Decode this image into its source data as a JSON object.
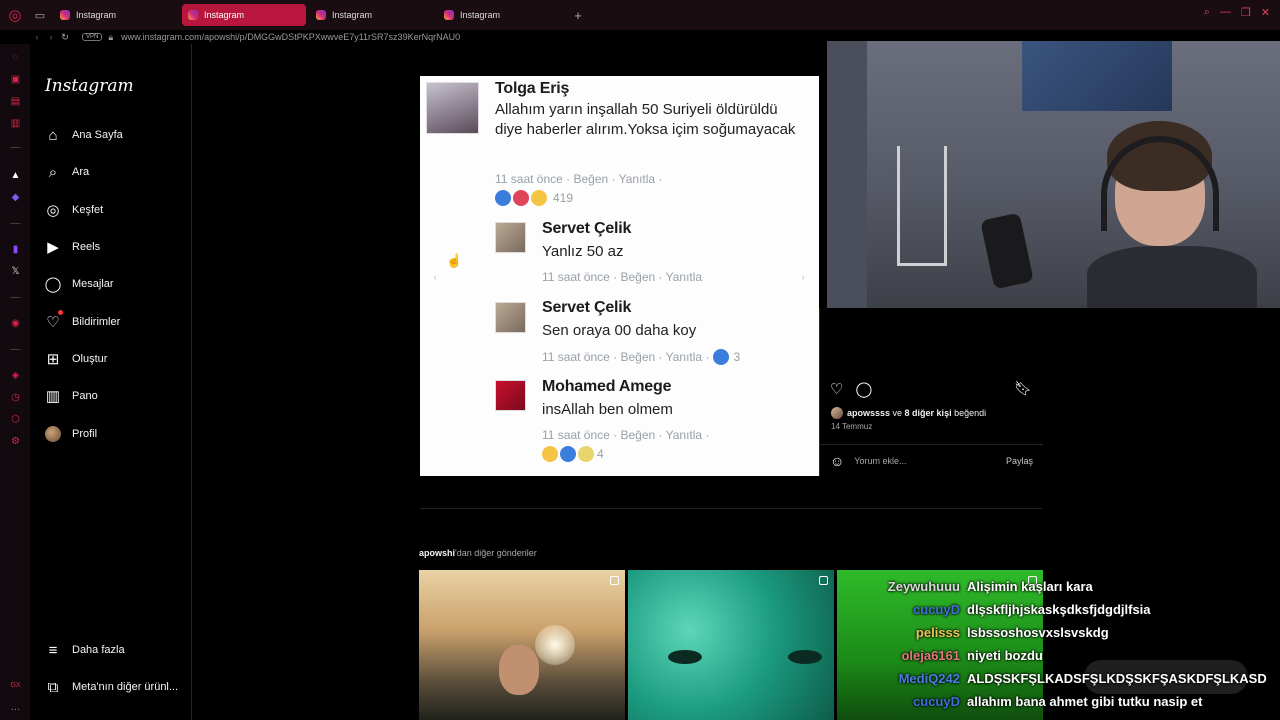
{
  "browser": {
    "tabs": [
      {
        "label": "Instagram",
        "active": false
      },
      {
        "label": "Instagram",
        "active": true
      },
      {
        "label": "Instagram",
        "active": false
      },
      {
        "label": "Instagram",
        "active": false
      }
    ],
    "new_tab": "+",
    "vpn": "VPN",
    "url": "www.instagram.com/apowshi/p/DMGGwDStPKPXwwveE7y11rSR7sz39KerNqrNAU0",
    "colors": {
      "accent": "#b8163c",
      "brand": "#d8264b"
    }
  },
  "instagram_nav": {
    "logo": "Instagram",
    "items": [
      {
        "label": "Ana Sayfa",
        "icon": "home-icon"
      },
      {
        "label": "Ara",
        "icon": "search-icon"
      },
      {
        "label": "Keşfet",
        "icon": "compass-icon"
      },
      {
        "label": "Reels",
        "icon": "reels-icon"
      },
      {
        "label": "Mesajlar",
        "icon": "messenger-icon"
      },
      {
        "label": "Bildirimler",
        "icon": "heart-icon"
      },
      {
        "label": "Oluştur",
        "icon": "plus-square-icon"
      },
      {
        "label": "Pano",
        "icon": "dashboard-icon"
      },
      {
        "label": "Profil",
        "icon": "avatar"
      }
    ],
    "more": "Daha fazla",
    "meta": "Meta'nın diğer ürünl..."
  },
  "post_image": {
    "comments": [
      {
        "name": "Tolga Eriş",
        "text": "Allahım yarın inşallah 50 Suriyeli öldürüldü diye haberler alırım.Yoksa içim soğumayacak",
        "meta": "11 saat önce · Beğen · Yanıtla ·",
        "count": "419"
      },
      {
        "name": "Servet Çelik",
        "text": "Yanlız 50 az",
        "meta": "11 saat önce · Beğen · Yanıtla"
      },
      {
        "name": "Servet Çelik",
        "text": "Sen oraya 00 daha koy",
        "meta": "11 saat önce · Beğen · Yanıtla ·",
        "count": "3"
      },
      {
        "name": "Mohamed Amege",
        "text": "insAllah ben olmem",
        "meta": "11 saat önce · Beğen · Yanıtla ·",
        "count": "4"
      }
    ]
  },
  "post_side": {
    "likes_user": "apowssss",
    "likes_mid": " ve ",
    "likes_others": "8 diğer kişi",
    "likes_tail": " beğendi",
    "date": "14 Temmuz",
    "comment_placeholder": "Yorum ekle...",
    "share": "Paylaş"
  },
  "more_posts": {
    "user": "apowshi",
    "suffix": "'dan diğer gönderiler"
  },
  "chat": [
    {
      "user": "Zeywuhuuu",
      "color": "#d9d9d9",
      "msg": "Alişimin kaşları kara"
    },
    {
      "user": "cucuyD",
      "color": "#3f6fd8",
      "msg": "dlşskfljhjskaskşdksfjdgdjlfsia"
    },
    {
      "user": "pelisss",
      "color": "#e9c55a",
      "msg": "lsbssoshosvxslsvskdg"
    },
    {
      "user": "oleja6161",
      "color": "#e07a7a",
      "msg": "niyeti bozdu"
    },
    {
      "user": "MediQ242",
      "color": "#4a7de0",
      "msg": "ALDŞSKFŞLKADSFŞLKDŞSKFŞASKDFŞLKASD"
    },
    {
      "user": "cucuyD",
      "color": "#3f6fd8",
      "msg": "allahım bana ahmet gibi tutku nasip et"
    }
  ]
}
